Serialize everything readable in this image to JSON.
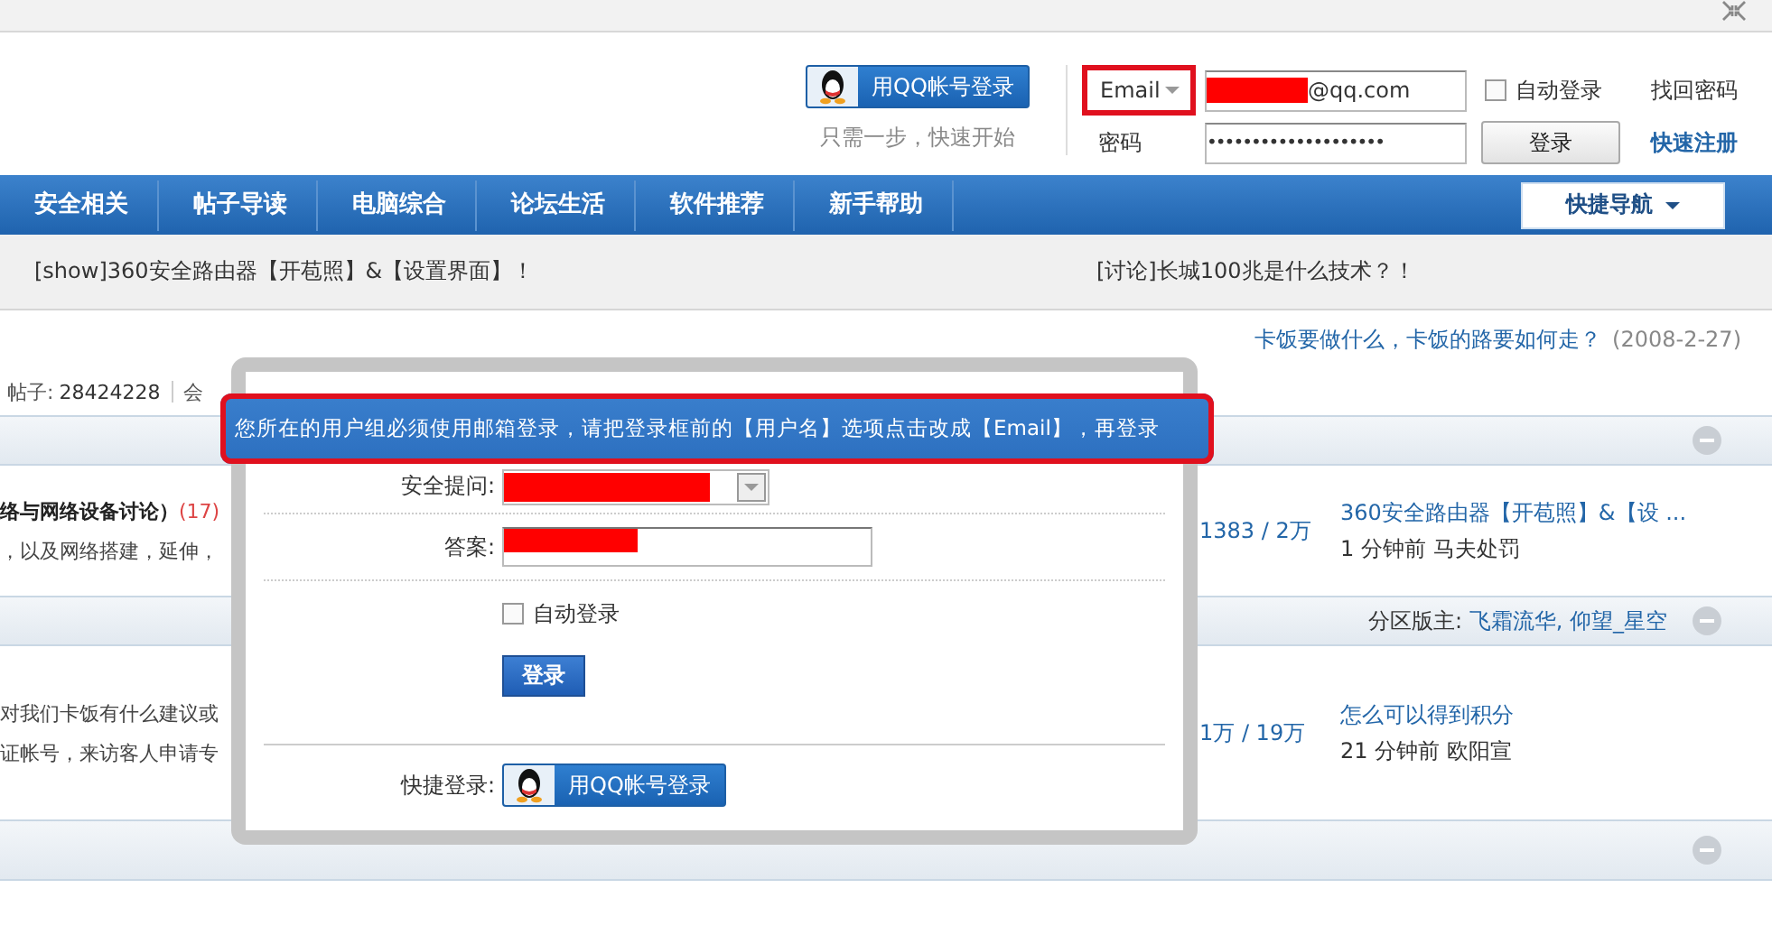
{
  "header": {
    "qq_login_button": "用QQ帐号登录",
    "qq_hint": "只需一步，快速开始",
    "account_type": {
      "value": "Email",
      "highlighted": true
    },
    "account_field": {
      "value": "@qq.com",
      "redacted": true
    },
    "auto_login": {
      "label": "自动登录",
      "checked": false
    },
    "recover_password": "找回密码",
    "password_label": "密码",
    "password_field": {
      "value": "••••••••••••••••••••"
    },
    "login_button": "登录",
    "register_link": "快速注册"
  },
  "nav": {
    "items": [
      {
        "label": "安全相关"
      },
      {
        "label": "帖子导读"
      },
      {
        "label": "电脑综合"
      },
      {
        "label": "论坛生活"
      },
      {
        "label": "软件推荐"
      },
      {
        "label": "新手帮助"
      }
    ],
    "quick_nav": "快捷导航"
  },
  "notices": [
    "[show]360安全路由器【开苞照】&【设置界面】！",
    "[讨论]长城100兆是什么技术？！"
  ],
  "announcement": {
    "title": "卡饭要做什么，卡饭的路要如何走？",
    "date": "(2008-2-27)"
  },
  "stats": {
    "posts_label": "帖子:",
    "posts": "28424228",
    "members_label": "会"
  },
  "sections": [
    {
      "expanded": true,
      "forum": {
        "title": "络与网络设备讨论）",
        "count": "(17)",
        "description": [
          "，以及网络搭建，延伸，"
        ],
        "stats": "1383 / 2万",
        "last_post": "360安全路由器【开苞照】&【设 ...",
        "last_time": "1 分钟前 马夫处罚"
      }
    },
    {
      "expanded": true,
      "moderators_label": "分区版主:",
      "moderators": "飞霜流华, 仰望_星空",
      "forum": {
        "description": [
          "对我们卡饭有什么建议或",
          "证帐号，来访客人申请专"
        ],
        "stats": "1万 / 19万",
        "last_post": "怎么可以得到积分",
        "last_time": "21 分钟前 欧阳宣"
      }
    },
    {
      "expanded": true
    }
  ],
  "modal": {
    "message": "您所在的用户组必须使用邮箱登录，请把登录框前的【用户名】选项点击改成【Email】，再登录",
    "message_highlighted": true,
    "question_label": "安全提问:",
    "question_redacted": true,
    "answer_label": "答案:",
    "answer_redacted": true,
    "auto_login": {
      "label": "自动登录",
      "checked": false
    },
    "login_button": "登录",
    "quick_login_label": "快捷登录:",
    "qq_button": "用QQ帐号登录"
  }
}
